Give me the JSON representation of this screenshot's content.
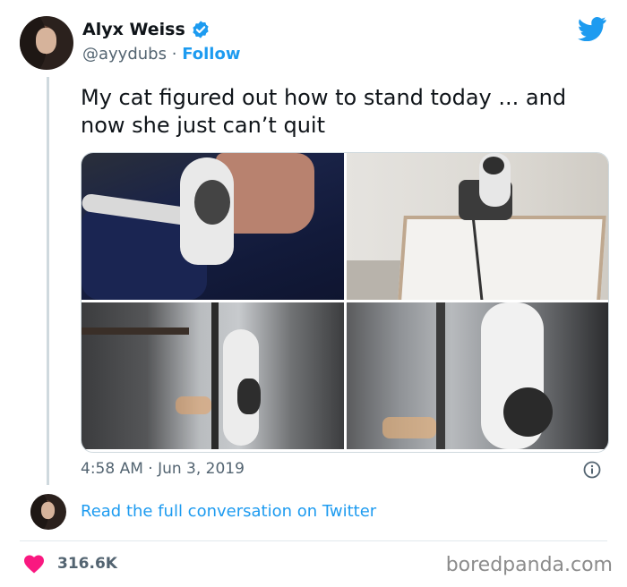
{
  "author": {
    "name": "Alyx Weiss",
    "handle": "@ayydubs",
    "separator": "·",
    "follow_label": "Follow"
  },
  "tweet": {
    "text": "My cat figured out how to stand today ... and now she just can’t quit",
    "timestamp": "4:58 AM · Jun 3, 2019"
  },
  "conversation_link": "Read the full conversation on Twitter",
  "likes": {
    "count": "316.6K"
  },
  "watermark": "boredpanda.com",
  "colors": {
    "accent": "#1d9bf0",
    "heart": "#f91880",
    "text": "#0f1419",
    "muted": "#536471"
  },
  "icons": [
    "verified-badge-icon",
    "twitter-bird-icon",
    "info-icon",
    "heart-icon"
  ]
}
